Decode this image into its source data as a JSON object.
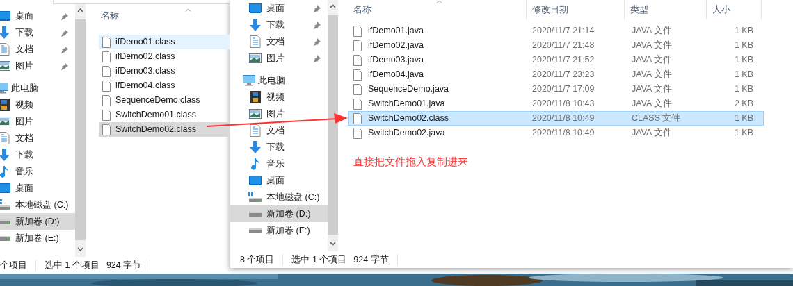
{
  "back_window": {
    "nav": {
      "pinned_items": [
        {
          "label": "桌面",
          "kind": "desktop",
          "pinned": true,
          "selected": false
        },
        {
          "label": "下载",
          "kind": "download",
          "pinned": true,
          "selected": false
        },
        {
          "label": "文档",
          "kind": "documents",
          "pinned": true,
          "selected": false
        },
        {
          "label": "图片",
          "kind": "pictures",
          "pinned": true,
          "selected": false
        }
      ],
      "this_pc": {
        "label": "此电脑",
        "children": [
          {
            "label": "视频",
            "kind": "videos",
            "pinned": false,
            "selected": false
          },
          {
            "label": "图片",
            "kind": "pictures",
            "pinned": false,
            "selected": false
          },
          {
            "label": "文档",
            "kind": "documents",
            "pinned": false,
            "selected": false
          },
          {
            "label": "下载",
            "kind": "download",
            "pinned": false,
            "selected": false
          },
          {
            "label": "音乐",
            "kind": "music",
            "pinned": false,
            "selected": false
          },
          {
            "label": "桌面",
            "kind": "desktop",
            "pinned": false,
            "selected": false
          },
          {
            "label": "本地磁盘 (C:)",
            "kind": "system_drive",
            "pinned": false,
            "selected": false
          },
          {
            "label": "新加卷 (D:)",
            "kind": "drive",
            "pinned": false,
            "selected": true
          },
          {
            "label": "新加卷 (E:)",
            "kind": "drive",
            "pinned": false,
            "selected": false
          }
        ]
      }
    },
    "column_header": "名称",
    "files": [
      {
        "name": "ifDemo01.class",
        "selected": false,
        "hovered": true
      },
      {
        "name": "ifDemo02.class",
        "selected": false,
        "hovered": false
      },
      {
        "name": "ifDemo03.class",
        "selected": false,
        "hovered": false
      },
      {
        "name": "ifDemo04.class",
        "selected": false,
        "hovered": false
      },
      {
        "name": "SequenceDemo.class",
        "selected": false,
        "hovered": false
      },
      {
        "name": "SwitchDemo01.class",
        "selected": false,
        "hovered": false
      },
      {
        "name": "SwitchDemo02.class",
        "selected": true,
        "hovered": false
      }
    ],
    "status_bar": [
      "个项目",
      "选中 1 个项目",
      "924 字节"
    ]
  },
  "front_window": {
    "nav": {
      "pinned_items": [
        {
          "label": "桌面",
          "kind": "desktop",
          "pinned": true,
          "selected": false
        },
        {
          "label": "下载",
          "kind": "download",
          "pinned": true,
          "selected": false
        },
        {
          "label": "文档",
          "kind": "documents",
          "pinned": true,
          "selected": false
        },
        {
          "label": "图片",
          "kind": "pictures",
          "pinned": true,
          "selected": false
        }
      ],
      "this_pc": {
        "label": "此电脑",
        "children": [
          {
            "label": "视频",
            "kind": "videos",
            "pinned": false,
            "selected": false
          },
          {
            "label": "图片",
            "kind": "pictures",
            "pinned": false,
            "selected": false
          },
          {
            "label": "文档",
            "kind": "documents",
            "pinned": false,
            "selected": false
          },
          {
            "label": "下载",
            "kind": "download",
            "pinned": false,
            "selected": false
          },
          {
            "label": "音乐",
            "kind": "music",
            "pinned": false,
            "selected": false
          },
          {
            "label": "桌面",
            "kind": "desktop",
            "pinned": false,
            "selected": false
          },
          {
            "label": "本地磁盘 (C:)",
            "kind": "system_drive",
            "pinned": false,
            "selected": false
          },
          {
            "label": "新加卷 (D:)",
            "kind": "drive",
            "pinned": false,
            "selected": true
          },
          {
            "label": "新加卷 (E:)",
            "kind": "drive",
            "pinned": false,
            "selected": false
          }
        ]
      }
    },
    "columns": [
      "名称",
      "修改日期",
      "类型",
      "大小"
    ],
    "files": [
      {
        "name": "ifDemo01.java",
        "modified": "2020/11/7 21:14",
        "type": "JAVA 文件",
        "size": "1 KB",
        "selected": false
      },
      {
        "name": "ifDemo02.java",
        "modified": "2020/11/7 21:48",
        "type": "JAVA 文件",
        "size": "1 KB",
        "selected": false
      },
      {
        "name": "ifDemo03.java",
        "modified": "2020/11/7 21:52",
        "type": "JAVA 文件",
        "size": "1 KB",
        "selected": false
      },
      {
        "name": "ifDemo04.java",
        "modified": "2020/11/7 23:23",
        "type": "JAVA 文件",
        "size": "1 KB",
        "selected": false
      },
      {
        "name": "SequenceDemo.java",
        "modified": "2020/11/7 17:09",
        "type": "JAVA 文件",
        "size": "1 KB",
        "selected": false
      },
      {
        "name": "SwitchDemo01.java",
        "modified": "2020/11/8 10:43",
        "type": "JAVA 文件",
        "size": "2 KB",
        "selected": false
      },
      {
        "name": "SwitchDemo02.class",
        "modified": "2020/11/8 10:49",
        "type": "CLASS 文件",
        "size": "1 KB",
        "selected": true
      },
      {
        "name": "SwitchDemo02.java",
        "modified": "2020/11/8 10:49",
        "type": "JAVA 文件",
        "size": "1 KB",
        "selected": false
      }
    ],
    "annotation": "直接把文件拖入复制进来",
    "status_bar": [
      "8 个项目",
      "选中 1 个项目",
      "924 字节"
    ]
  }
}
